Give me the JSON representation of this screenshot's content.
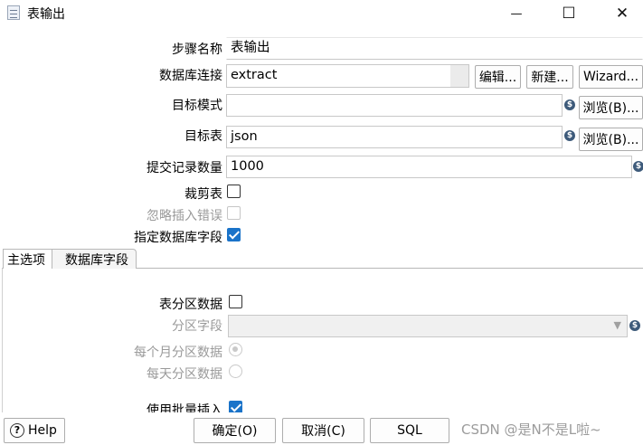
{
  "window": {
    "title": "表输出",
    "minimize_glyph": "—",
    "maximize_glyph": "☐",
    "close_glyph": "✕"
  },
  "form": {
    "step_name_label": "步骤名称",
    "step_name_value": "表输出",
    "db_connection_label": "数据库连接",
    "db_connection_value": "extract",
    "edit_button": "编辑...",
    "new_button": "新建...",
    "wizard_button": "Wizard...",
    "target_schema_label": "目标模式",
    "target_schema_value": "",
    "browse_schema_button": "浏览(B)...",
    "target_table_label": "目标表",
    "target_table_value": "json",
    "browse_table_button": "浏览(B)...",
    "commit_size_label": "提交记录数量",
    "commit_size_value": "1000",
    "truncate_label": "裁剪表",
    "ignore_errors_label": "忽略插入错误",
    "specify_fields_label": "指定数据库字段"
  },
  "tabs": [
    {
      "label": "主选项"
    },
    {
      "label": "数据库字段"
    }
  ],
  "main_options": {
    "partition_label": "表分区数据",
    "partition_field_label": "分区字段",
    "partition_field_value": "",
    "monthly_label": "每个月分区数据",
    "daily_label": "每天分区数据",
    "batch_insert_label": "使用批量插入"
  },
  "buttons": {
    "help": "Help",
    "ok": "确定(O)",
    "cancel": "取消(C)",
    "sql": "SQL"
  },
  "watermark": "CSDN @是N不是L啦~",
  "icons": {
    "variable_icon_glyph": "$",
    "help_icon_glyph": "?",
    "dropdown_glyph": "▼"
  }
}
